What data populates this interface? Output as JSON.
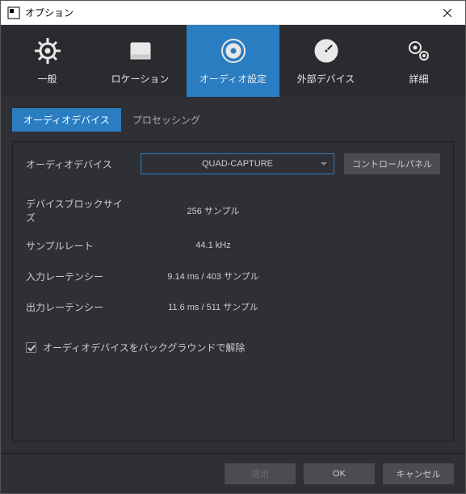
{
  "titlebar": {
    "title": "オプション"
  },
  "toolbar": {
    "items": [
      {
        "label": "一般"
      },
      {
        "label": "ロケーション"
      },
      {
        "label": "オーディオ設定"
      },
      {
        "label": "外部デバイス"
      },
      {
        "label": "詳細"
      }
    ]
  },
  "tabs": {
    "items": [
      {
        "label": "オーディオデバイス"
      },
      {
        "label": "プロセッシング"
      }
    ]
  },
  "device": {
    "label": "オーディオデバイス",
    "value": "QUAD-CAPTURE",
    "control_panel": "コントロールパネル"
  },
  "info": {
    "block_label": "デバイスブロックサイズ",
    "block_value": "256 サンプル",
    "rate_label": "サンプルレート",
    "rate_value": "44.1 kHz",
    "in_lat_label": "入力レーテンシー",
    "in_lat_value": "9.14 ms / 403 サンプル",
    "out_lat_label": "出力レーテンシー",
    "out_lat_value": "11.6 ms / 511 サンプル"
  },
  "checkbox": {
    "label": "オーディオデバイスをバックグラウンドで解除"
  },
  "footer": {
    "apply": "適用",
    "ok": "OK",
    "cancel": "キャンセル"
  }
}
